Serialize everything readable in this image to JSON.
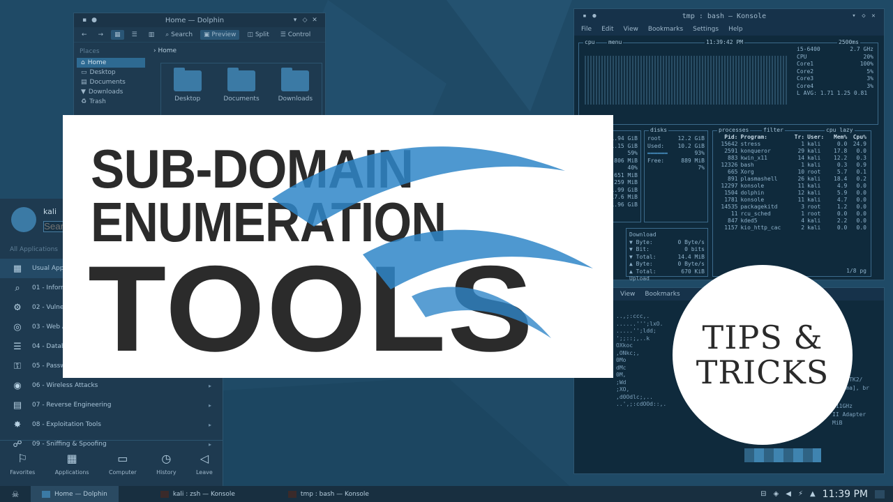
{
  "colors": {
    "desktop_bg": "#1f4a66",
    "accent": "#3b7aa5",
    "banner_bg": "#ffffff",
    "title_text": "#2b2b2b"
  },
  "dolphin": {
    "title": "Home — Dolphin",
    "toolbar": {
      "search": "Search",
      "preview": "Preview",
      "split": "Split",
      "control": "Control"
    },
    "places_header": "Places",
    "places": [
      "Home",
      "Desktop",
      "Documents",
      "Downloads",
      "Trash"
    ],
    "breadcrumb": "Home",
    "folders": [
      "Desktop",
      "Documents",
      "Downloads"
    ]
  },
  "konsole_top": {
    "title": "tmp : bash — Konsole",
    "menu": [
      "File",
      "Edit",
      "View",
      "Bookmarks",
      "Settings",
      "Help"
    ],
    "cpu_label": "cpu",
    "menu_label": "menu",
    "time": "11:39:42 PM",
    "interval": "2500ms",
    "cpu_model": "i5-6400",
    "cpu_freq": "2.7 GHz",
    "cores": [
      {
        "name": "CPU",
        "pct": "20%"
      },
      {
        "name": "Core1",
        "pct": "100%"
      },
      {
        "name": "Core2",
        "pct": "5%"
      },
      {
        "name": "Core3",
        "pct": "3%"
      },
      {
        "name": "Core4",
        "pct": "3%"
      }
    ],
    "load_avg": "L AVG: 1.71 1.25 0.81",
    "mem_label": "mem",
    "mem_values": [
      "1.94 GiB",
      "1.15 GiB",
      "59%",
      "806 MiB",
      "40%",
      "651 MiB",
      "259 MiB",
      "1.99 GiB",
      "17.6 MiB",
      "1.96 GiB"
    ],
    "disks_label": "disks",
    "disks": {
      "mount": "root",
      "size": "12.2 GiB",
      "used_label": "Used:",
      "used": "10.2 GiB",
      "used_pct": "93%",
      "free_label": "Free:",
      "free": "889 MiB",
      "free_pct": "7%"
    },
    "proc_label": "processes",
    "filter_label": "filter",
    "cpu_lazy": "cpu lazy",
    "proc_headers": [
      "Pid:",
      "Program:",
      "Tr:",
      "User:",
      "Mem%",
      "Cpu%"
    ],
    "processes": [
      [
        "15642",
        "stress",
        "1",
        "kali",
        "0.0",
        "24.9"
      ],
      [
        "2591",
        "konqueror",
        "29",
        "kali",
        "17.8",
        "0.0"
      ],
      [
        "883",
        "kwin_x11",
        "14",
        "kali",
        "12.2",
        "0.3"
      ],
      [
        "12326",
        "bash",
        "1",
        "kali",
        "0.3",
        "0.9"
      ],
      [
        "665",
        "Xorg",
        "10",
        "root",
        "5.7",
        "0.1"
      ],
      [
        "891",
        "plasmashell",
        "26",
        "kali",
        "18.4",
        "0.2"
      ],
      [
        "12297",
        "konsole",
        "11",
        "kali",
        "4.9",
        "0.0"
      ],
      [
        "1504",
        "dolphin",
        "12",
        "kali",
        "5.9",
        "0.0"
      ],
      [
        "1781",
        "konsole",
        "11",
        "kali",
        "4.7",
        "0.0"
      ],
      [
        "14535",
        "packagekitd",
        "3",
        "root",
        "1.2",
        "0.0"
      ],
      [
        "11",
        "rcu_sched",
        "1",
        "root",
        "0.0",
        "0.0"
      ],
      [
        "847",
        "kded5",
        "4",
        "kali",
        "2.2",
        "0.0"
      ],
      [
        "1157",
        "kio_http_cac",
        "2",
        "kali",
        "0.0",
        "0.0"
      ]
    ],
    "page": "1/8 pg",
    "net": {
      "download": "Download",
      "rows": [
        [
          "Byte:",
          "0 Byte/s"
        ],
        [
          "Bit:",
          "0 bits"
        ],
        [
          "Total:",
          "14.4 MiB"
        ],
        [
          "Byte:",
          "0 Byte/s"
        ],
        [
          "Total:",
          "670 KiB"
        ]
      ],
      "upload": "Upload"
    }
  },
  "konsole_bottom": {
    "menu": [
      "View",
      "Bookmarks"
    ],
    "lines": [
      "..,;:ccc,.",
      "......''';lxO.",
      ".....'';ldd;",
      "';;::;,..k",
      "OXkoc",
      ",ONkc;,",
      "0Mo",
      "dMc",
      "0M,",
      ";Wd",
      ";XO,",
      ",d0Odlc;,..",
      "..',;:cdOOd::,."
    ],
    "info": [
      "ze [GTK2/",
      "Plasma], br",
      "711GHz",
      "II Adapter",
      "MiB"
    ]
  },
  "launcher": {
    "user": "kali",
    "search_placeholder": "Search...",
    "all_apps": "All Applications",
    "categories": [
      {
        "icon": "usual-apps-icon",
        "glyph": "▦",
        "label": "Usual Applications"
      },
      {
        "icon": "info-gathering-icon",
        "glyph": "⌕",
        "label": "01 - Information Gathering"
      },
      {
        "icon": "vuln-analysis-icon",
        "glyph": "⚙",
        "label": "02 - Vulnerability Analysis"
      },
      {
        "icon": "web-apps-icon",
        "glyph": "◎",
        "label": "03 - Web Application Analysis"
      },
      {
        "icon": "database-icon",
        "glyph": "☰",
        "label": "04 - Database Assessment"
      },
      {
        "icon": "password-icon",
        "glyph": "⚿",
        "label": "05 - Password Attacks"
      },
      {
        "icon": "wireless-icon",
        "glyph": "◉",
        "label": "06 - Wireless Attacks"
      },
      {
        "icon": "reverse-eng-icon",
        "glyph": "▤",
        "label": "07 - Reverse Engineering"
      },
      {
        "icon": "exploit-icon",
        "glyph": "✸",
        "label": "08 - Exploitation Tools"
      },
      {
        "icon": "sniffing-icon",
        "glyph": "☍",
        "label": "09 - Sniffing & Spoofing"
      }
    ],
    "footer": [
      {
        "icon": "bookmark-icon",
        "glyph": "⚐",
        "label": "Favorites"
      },
      {
        "icon": "apps-grid-icon",
        "glyph": "▦",
        "label": "Applications"
      },
      {
        "icon": "computer-icon",
        "glyph": "▭",
        "label": "Computer"
      },
      {
        "icon": "history-icon",
        "glyph": "◷",
        "label": "History"
      },
      {
        "icon": "leave-icon",
        "glyph": "◁",
        "label": "Leave"
      }
    ]
  },
  "taskbar": {
    "tasks": [
      "Home — Dolphin",
      "kali : zsh — Konsole",
      "tmp : bash — Konsole"
    ],
    "clock": "11:39 PM"
  },
  "banner": {
    "line1": "SUB-DOMAIN",
    "line2": "ENUMERATION",
    "line3": "TOOLS"
  },
  "badge": {
    "line1": "TIPS &",
    "line2": "TRICKS"
  }
}
